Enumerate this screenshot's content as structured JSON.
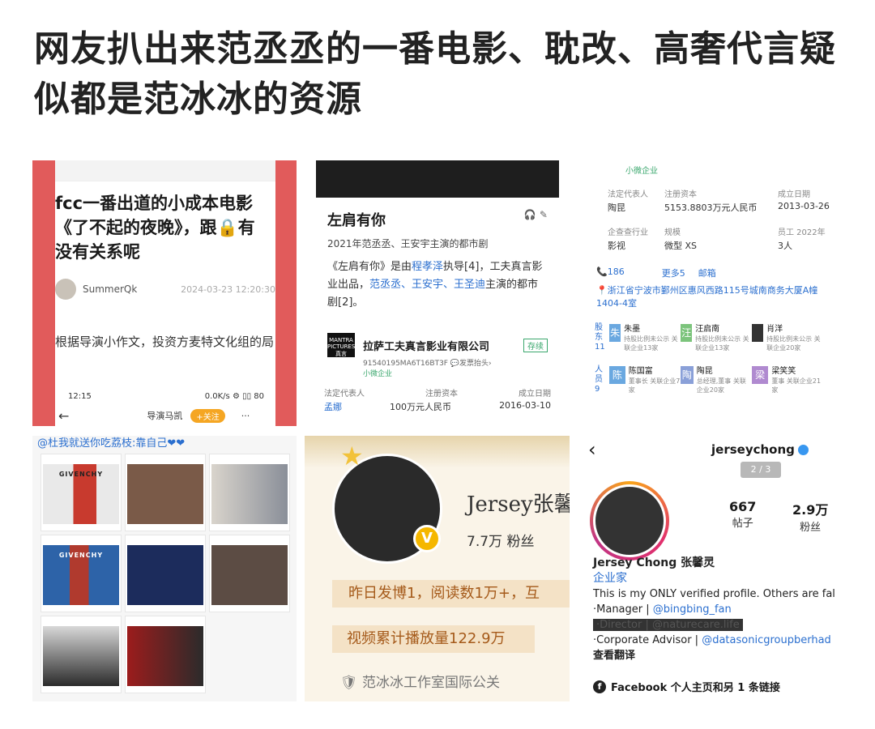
{
  "headline": "网友扒出来范丞丞的一番电影、耽改、高奢代言疑似都是范冰冰的资源",
  "p1": {
    "title": "fcc一番出道的小成本电影《了不起的夜晚》，跟🔒有没有关系呢",
    "author": "SummerQk",
    "time": "2024-03-23 12:20:30",
    "body": "根据导演小作文，投资方麦特文化组的局",
    "status_time": "12:15",
    "status_right": "0.0K/s ⚙ ▯▯ 80",
    "bottom_user": "导演马凯",
    "follow": "+关注",
    "more": "···",
    "back": "←"
  },
  "p2": {
    "name": "左肩有你",
    "sub": "2021年范丞丞、王安宇主演的都市剧",
    "desc_pre": "《左肩有你》是由",
    "director": "程孝泽",
    "desc_mid": "执导[4]，工夫真言影业出品，",
    "stars": "范丞丞、王安宇、王圣迪",
    "desc_post": "主演的都市剧[2]。",
    "company": "拉萨工夫真言影业有限公司",
    "company_tag": "存续",
    "company_code": "91540195MA6T16BT3F  💬发票抬头›",
    "company_type": "小微企业",
    "logo_text": "MANTRA PICTURES 真言",
    "col1": "法定代表人",
    "col2": "注册资本",
    "col3": "成立日期",
    "val1": "孟娜",
    "val2": "100万元人民币",
    "val3": "2016-03-10"
  },
  "p3": {
    "badge": "小微企业",
    "legal_label": "法定代表人",
    "capital_label": "注册资本",
    "date_label": "成立日期",
    "legal": "陶昆",
    "capital": "5153.8803万元人民币",
    "date": "2013-03-26",
    "industry_label": "企查查行业",
    "scale_label": "规模",
    "staff_label": "员工 2022年",
    "industry": "影视",
    "scale": "微型 XS",
    "staff": "3人",
    "phone": "📞186",
    "more": "更多5",
    "email": "邮箱",
    "address": "📍浙江省宁波市鄞州区惠风西路115号城南商务大厦A幢1404-4室",
    "shareholder_label": "股东 11",
    "people_label": "人员 9",
    "shareholders": [
      {
        "icon": "朱",
        "name": "朱墨",
        "note": "持股比例未公示 关联企业13家",
        "color": "#6aa8e0"
      },
      {
        "icon": "汪",
        "name": "汪启南",
        "note": "持股比例未公示 关联企业13家",
        "color": "#7cc47c"
      },
      {
        "icon": "",
        "name": "肖洋",
        "note": "持股比例未公示 关联企业20家",
        "color": "#333333"
      }
    ],
    "people": [
      {
        "icon": "陈",
        "name": "陈国富",
        "note": "董事长 关联企业7家",
        "color": "#6aa8e0"
      },
      {
        "icon": "陶",
        "name": "陶昆",
        "note": "总经理,董事 关联企业20家",
        "color": "#8aa0d8"
      },
      {
        "icon": "梁",
        "name": "梁笑笑",
        "note": "董事 关联企业21家",
        "color": "#b08ad0"
      }
    ]
  },
  "p4": {
    "caption": "@杜我就送你吃荔枝:靠自己❤❤",
    "brand": "GIVENCHY",
    "brand2": "GIVENCHY"
  },
  "p5": {
    "name": "Jersey张馨",
    "fans": "7.7万  粉丝",
    "line1": "昨日发博1，阅读数1万+，互",
    "line2": "视频累计播放量122.9万",
    "line3": "范冰冰工作室国际公关",
    "badge": "V"
  },
  "p6": {
    "back": "‹",
    "username": "jerseychong",
    "pager": "2 / 3",
    "posts_n": "667",
    "posts_l": "帖子",
    "fans_n": "2.9万",
    "fans_l": "粉丝",
    "fullname": "Jersey Chong 张馨灵",
    "category": "企业家",
    "bio1": "This is my ONLY verified profile. Others are fal",
    "bio2_pre": "·Manager | ",
    "bio2_link": "@bingbing_fan",
    "bio3": "·Director | @naturecare.life",
    "bio4_pre": "·Corporate Advisor | ",
    "bio4_link": "@datasonicgroupberhad",
    "translate": "查看翻译",
    "facebook": "Facebook 个人主页和另 1 条链接",
    "fb_icon": "f"
  }
}
